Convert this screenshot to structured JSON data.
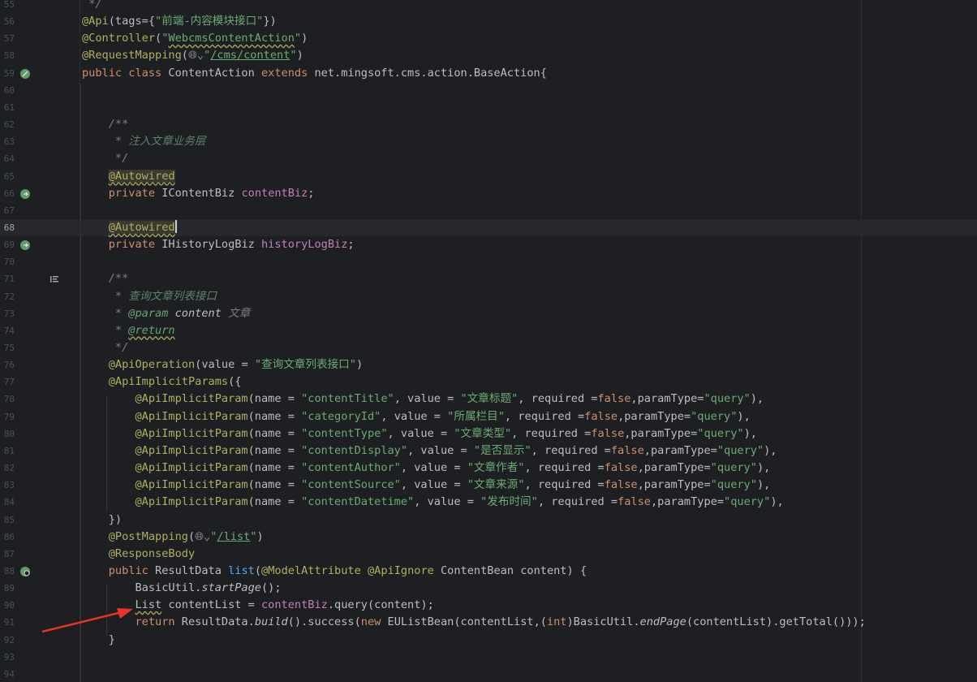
{
  "editor": {
    "current_line": "68",
    "lines": [
      {
        "n": "55",
        "t": " */"
      },
      {
        "n": "56",
        "t": "@Api(tags={\"前端-内容模块接口\"})"
      },
      {
        "n": "57",
        "t": "@Controller(\"WebcmsContentAction\")"
      },
      {
        "n": "58",
        "t": "@RequestMapping(\"/cms/content\")"
      },
      {
        "n": "59",
        "t": "public class ContentAction extends net.mingsoft.cms.action.BaseAction{"
      },
      {
        "n": "60",
        "t": ""
      },
      {
        "n": "61",
        "t": ""
      },
      {
        "n": "62",
        "t": "    /**"
      },
      {
        "n": "63",
        "t": "     * 注入文章业务层"
      },
      {
        "n": "64",
        "t": "     */"
      },
      {
        "n": "65",
        "t": "    @Autowired"
      },
      {
        "n": "66",
        "t": "    private IContentBiz contentBiz;"
      },
      {
        "n": "67",
        "t": ""
      },
      {
        "n": "68",
        "t": "    @Autowired"
      },
      {
        "n": "69",
        "t": "    private IHistoryLogBiz historyLogBiz;"
      },
      {
        "n": "70",
        "t": ""
      },
      {
        "n": "71",
        "t": "    /**"
      },
      {
        "n": "72",
        "t": "     * 查询文章列表接口"
      },
      {
        "n": "73",
        "t": "     * @param content 文章"
      },
      {
        "n": "74",
        "t": "     * @return"
      },
      {
        "n": "75",
        "t": "     */"
      },
      {
        "n": "76",
        "t": "    @ApiOperation(value = \"查询文章列表接口\")"
      },
      {
        "n": "77",
        "t": "    @ApiImplicitParams({"
      },
      {
        "n": "78",
        "t": "        @ApiImplicitParam(name = \"contentTitle\", value = \"文章标题\", required =false,paramType=\"query\"),"
      },
      {
        "n": "79",
        "t": "        @ApiImplicitParam(name = \"categoryId\", value = \"所属栏目\", required =false,paramType=\"query\"),"
      },
      {
        "n": "80",
        "t": "        @ApiImplicitParam(name = \"contentType\", value = \"文章类型\", required =false,paramType=\"query\"),"
      },
      {
        "n": "81",
        "t": "        @ApiImplicitParam(name = \"contentDisplay\", value = \"是否显示\", required =false,paramType=\"query\"),"
      },
      {
        "n": "82",
        "t": "        @ApiImplicitParam(name = \"contentAuthor\", value = \"文章作者\", required =false,paramType=\"query\"),"
      },
      {
        "n": "83",
        "t": "        @ApiImplicitParam(name = \"contentSource\", value = \"文章来源\", required =false,paramType=\"query\"),"
      },
      {
        "n": "84",
        "t": "        @ApiImplicitParam(name = \"contentDatetime\", value = \"发布时间\", required =false,paramType=\"query\"),"
      },
      {
        "n": "85",
        "t": "    })"
      },
      {
        "n": "86",
        "t": "    @PostMapping(\"/list\")"
      },
      {
        "n": "87",
        "t": "    @ResponseBody"
      },
      {
        "n": "88",
        "t": "    public ResultData list(@ModelAttribute @ApiIgnore ContentBean content) {"
      },
      {
        "n": "89",
        "t": "        BasicUtil.startPage();"
      },
      {
        "n": "90",
        "t": "        List contentList = contentBiz.query(content);"
      },
      {
        "n": "91",
        "t": "        return ResultData.build().success(new EUListBean(contentList,(int)BasicUtil.endPage(contentList).getTotal()));"
      },
      {
        "n": "92",
        "t": "    }"
      },
      {
        "n": "93",
        "t": ""
      },
      {
        "n": "94",
        "t": ""
      }
    ]
  },
  "gutter_icons": {
    "59": "bean-icon",
    "66": "autowired-navigate-icon",
    "69": "autowired-navigate-icon",
    "71": "rendered-doc-toggle-icon",
    "88": "endpoint-icon"
  },
  "mapping_icon": "web-globe-dropdown-icon",
  "annotation_arrow_color": "#e8332a",
  "colors": {
    "background": "#1e1f22",
    "keyword": "#cf8e6d",
    "annotation": "#b3ae60",
    "string": "#6aab73",
    "field": "#c77dbb",
    "method_decl": "#56a8f5",
    "comment": "#7a7e85"
  }
}
